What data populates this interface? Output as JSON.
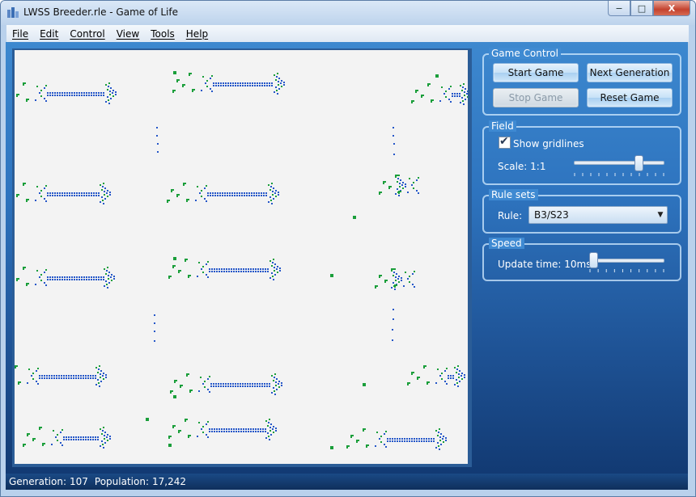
{
  "window": {
    "title": "LWSS Breeder.rle - Game of Life",
    "minimize_label": "−",
    "maximize_label": "□",
    "close_label": "X"
  },
  "menu": [
    {
      "label": "File"
    },
    {
      "label": "Edit"
    },
    {
      "label": "Control"
    },
    {
      "label": "View"
    },
    {
      "label": "Tools"
    },
    {
      "label": "Help"
    }
  ],
  "game_control": {
    "title": "Game Control",
    "start_label": "Start Game",
    "next_label": "Next Generation",
    "stop_label": "Stop Game",
    "reset_label": "Reset Game",
    "stop_enabled": false
  },
  "field": {
    "title": "Field",
    "show_gridlines_label": "Show gridlines",
    "show_gridlines": true,
    "scale_label": "Scale: 1:1",
    "scale_level": 0.75
  },
  "rule_sets": {
    "title": "Rule sets",
    "rule_label": "Rule:",
    "rule_value": "B3/S23"
  },
  "speed": {
    "title": "Speed",
    "update_label": "Update time: 10ms",
    "speed_level": 0.0
  },
  "status": {
    "generation_label": "Generation:",
    "generation_value": "107",
    "population_label": "Population:",
    "population_value": "17,242"
  },
  "colors": {
    "cell_green": "#1a9e3a",
    "cell_blue": "#2456c8",
    "board_bg": "#f3f3f3"
  }
}
